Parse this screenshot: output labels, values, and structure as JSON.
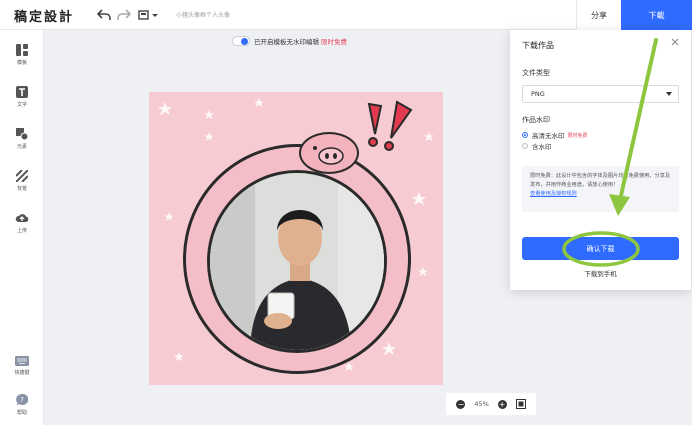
{
  "app": {
    "logo": "稿定設計",
    "doc_title": "小猪头像框个人头像"
  },
  "header": {
    "share_label": "分享",
    "download_label": "下載"
  },
  "sidebar": {
    "items": [
      {
        "label": "模板",
        "icon": "template-icon"
      },
      {
        "label": "文字",
        "icon": "text-icon"
      },
      {
        "label": "元素",
        "icon": "elements-icon"
      },
      {
        "label": "背景",
        "icon": "background-icon"
      },
      {
        "label": "上传",
        "icon": "upload-icon"
      }
    ],
    "bottom": [
      {
        "label": "快捷键",
        "icon": "keyboard-icon"
      },
      {
        "label": "帮助",
        "icon": "help-icon"
      }
    ]
  },
  "canvas": {
    "watermark_text": "已开启模板无水印编辑",
    "watermark_link": "限时免费",
    "zoom": "45%"
  },
  "download_panel": {
    "title": "下载作品",
    "file_type_label": "文件类型",
    "file_type_value": "PNG",
    "watermark_label": "作品水印",
    "option_no_watermark": "高清无水印",
    "option_no_watermark_tag": "限时免费",
    "option_with_watermark": "含水印",
    "notice_text": "限时免费：此设计中包含的字体及图片均可免费使用、分享及发布，并用作商业用途，请放心使用！",
    "notice_link": "查看使用及授权规则",
    "confirm_label": "确认下载",
    "phone_label": "下载到手机"
  },
  "colors": {
    "accent": "#2f6bff",
    "highlight": "#8dc63f",
    "artboard": "#f6ccd2"
  }
}
